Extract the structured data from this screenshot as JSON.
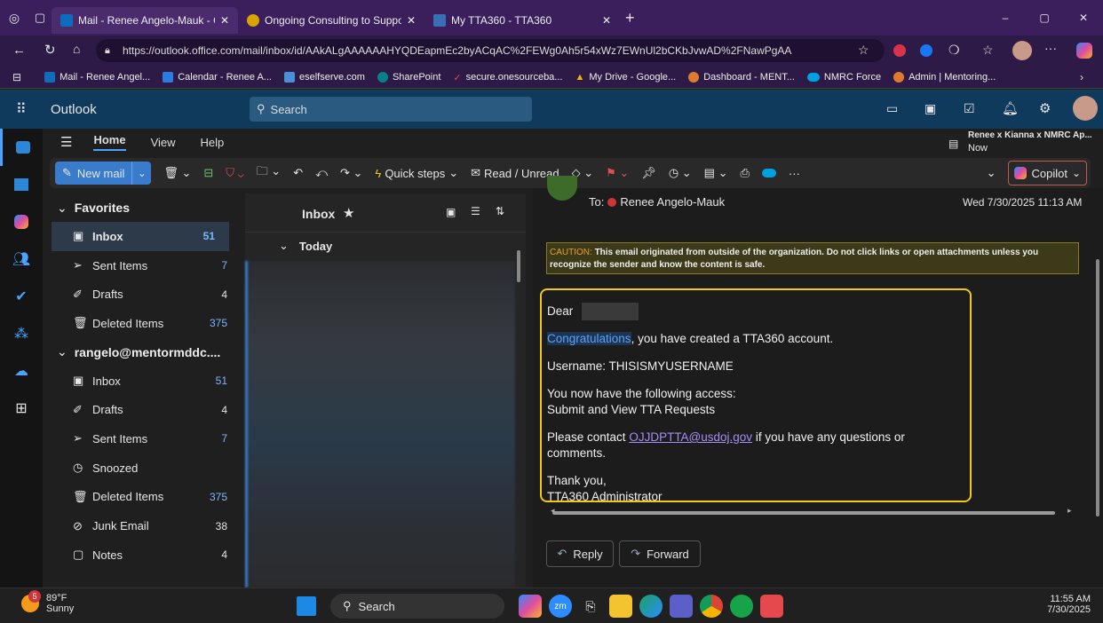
{
  "browser": {
    "tabs": [
      {
        "label": "Mail - Renee Angelo-Mauk - Outl",
        "color": "#0f6cbd"
      },
      {
        "label": "Ongoing Consulting to Support N",
        "color": "#d9a300"
      },
      {
        "label": "My TTA360 - TTA360",
        "color": "#3a6fb5"
      }
    ],
    "url": "https://outlook.office.com/mail/inbox/id/AAkALgAAAAAAHYQDEapmEc2byACqAC%2FEWg0Ah5r54xWz7EWnUl2bCKbJvwAD%2FNawPgAA",
    "bookmarks": [
      {
        "label": "Mail - Renee Angel...",
        "color": "#0f6cbd"
      },
      {
        "label": "Calendar - Renee A...",
        "color": "#2a7de1"
      },
      {
        "label": "eselfserve.com",
        "color": "#4a90d9"
      },
      {
        "label": "SharePoint",
        "color": "#038387"
      },
      {
        "label": "secure.onesourceba...",
        "color": "#e04b4b"
      },
      {
        "label": "My Drive - Google...",
        "color": "#f4b400"
      },
      {
        "label": "Dashboard - MENT...",
        "color": "#e07b2e"
      },
      {
        "label": "NMRC Force",
        "color": "#00a1e0"
      },
      {
        "label": "Admin | Mentoring...",
        "color": "#e07b2e"
      }
    ]
  },
  "outlook": {
    "app_name": "Outlook",
    "search_placeholder": "Search",
    "ribbon_tabs": [
      "Home",
      "View",
      "Help"
    ],
    "notification": {
      "title": "Renee x Kianna x NMRC Ap...",
      "time": "Now"
    },
    "toolbar": {
      "new_mail": "New mail",
      "quick_steps": "Quick steps",
      "read_unread": "Read / Unread",
      "copilot": "Copilot"
    },
    "favorites_label": "Favorites",
    "favorites": [
      {
        "label": "Inbox",
        "count": "51",
        "icon": "inbox-icon",
        "selected": true
      },
      {
        "label": "Sent Items",
        "count": "7",
        "icon": "send-icon"
      },
      {
        "label": "Drafts",
        "count": "4",
        "icon": "pencil-icon"
      },
      {
        "label": "Deleted Items",
        "count": "375",
        "icon": "trash-icon"
      }
    ],
    "account_label": "rangelo@mentormddc....",
    "account_folders": [
      {
        "label": "Inbox",
        "count": "51",
        "icon": "inbox-icon"
      },
      {
        "label": "Drafts",
        "count": "4",
        "icon": "pencil-icon"
      },
      {
        "label": "Sent Items",
        "count": "7",
        "icon": "send-icon"
      },
      {
        "label": "Snoozed",
        "count": "",
        "icon": "clock-icon"
      },
      {
        "label": "Deleted Items",
        "count": "375",
        "icon": "trash-icon"
      },
      {
        "label": "Junk Email",
        "count": "38",
        "icon": "junk-icon"
      },
      {
        "label": "Notes",
        "count": "4",
        "icon": "note-icon"
      }
    ],
    "list_title": "Inbox",
    "group_label": "Today",
    "email": {
      "to_label": "To:",
      "to_name": "Renee Angelo-Mauk",
      "date": "Wed 7/30/2025 11:13 AM",
      "caution_prefix": "CAUTION:",
      "caution_text": "This email originated from outside of the organization. Do not click links or open attachments unless you recognize the sender and know the content is safe.",
      "greeting": "Dear",
      "congrats_word": "Congratulations",
      "congrats_rest": ", you have created a TTA360 account.",
      "username_line": "Username: THISISMYUSERNAME",
      "access_line1": "You now have the following access:",
      "access_line2": "Submit and View TTA Requests",
      "contact_pre": "Please contact ",
      "contact_link": "OJJDPTTA@usdoj.gov",
      "contact_post": " if you have any questions or comments.",
      "thanks": "Thank you,",
      "signature": "TTA360 Administrator"
    },
    "reply_label": "Reply",
    "forward_label": "Forward"
  },
  "taskbar": {
    "weather_temp": "89°F",
    "weather_desc": "Sunny",
    "weather_badge": "5",
    "search_label": "Search",
    "time": "11:55 AM",
    "date": "7/30/2025"
  },
  "colors": {
    "accent": "#0f6cbd",
    "highlight_border": "#f2c811",
    "caution_bg": "#3d3a1a",
    "caution_border": "#8a7a1e"
  }
}
